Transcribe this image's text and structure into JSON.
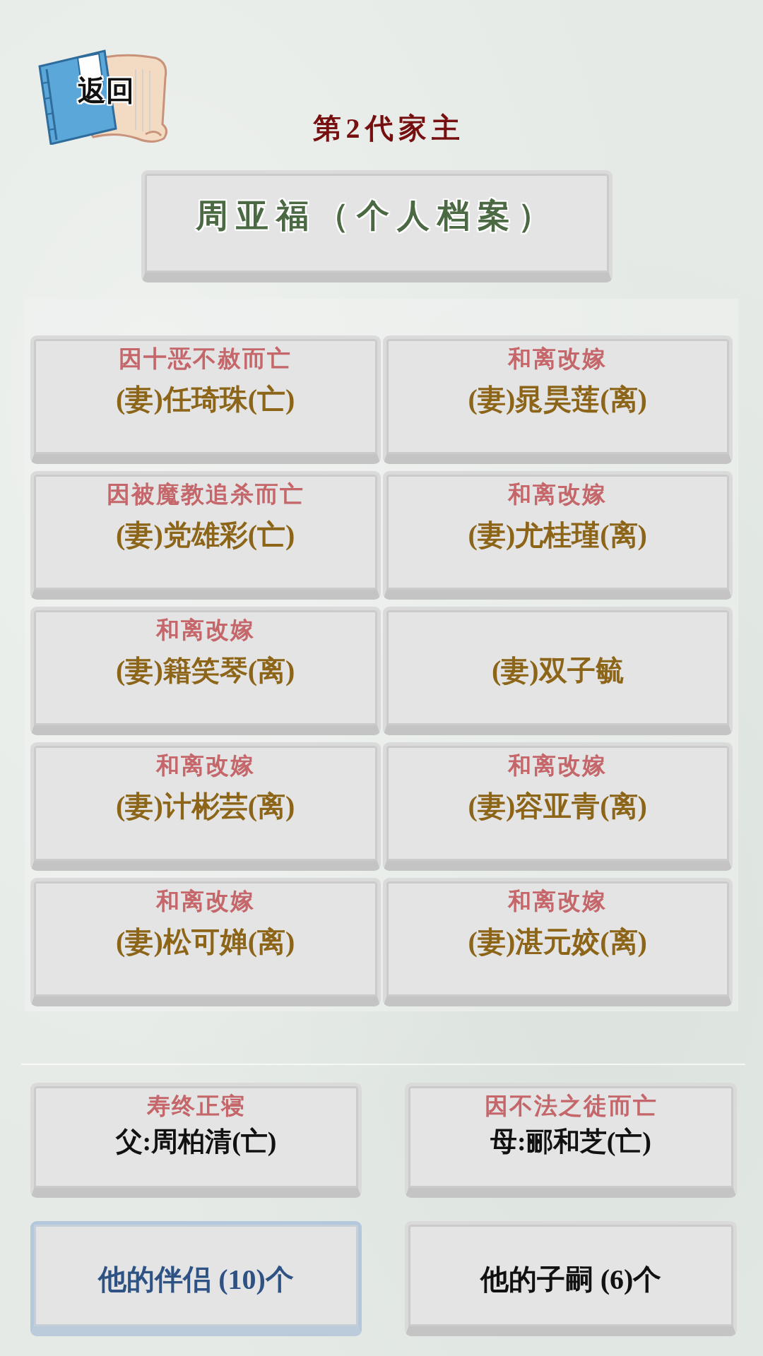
{
  "back_button": {
    "label": "返回"
  },
  "title": "第2代家主",
  "profile_button": {
    "label": "周亚福（个人档案）"
  },
  "spouses": [
    {
      "status": "因十恶不赦而亡",
      "name": "(妻)任琦珠(亡)"
    },
    {
      "status": "和离改嫁",
      "name": "(妻)晁昊莲(离)"
    },
    {
      "status": "因被魔教追杀而亡",
      "name": "(妻)党雄彩(亡)"
    },
    {
      "status": "和离改嫁",
      "name": "(妻)尤桂瑾(离)"
    },
    {
      "status": "和离改嫁",
      "name": "(妻)籍笑琴(离)"
    },
    {
      "name": "(妻)双子毓"
    },
    {
      "status": "和离改嫁",
      "name": "(妻)计彬芸(离)"
    },
    {
      "status": "和离改嫁",
      "name": "(妻)容亚青(离)"
    },
    {
      "status": "和离改嫁",
      "name": "(妻)松可婵(离)"
    },
    {
      "status": "和离改嫁",
      "name": "(妻)湛元姣(离)"
    }
  ],
  "parents": [
    {
      "status": "寿终正寝",
      "name": "父:周柏清(亡)"
    },
    {
      "status": "因不法之徒而亡",
      "name": "母:郦和芝(亡)"
    }
  ],
  "tabs": [
    {
      "label": "他的伴侣 (10)个",
      "selected": true
    },
    {
      "label": "他的子嗣 (6)个",
      "selected": false
    }
  ]
}
